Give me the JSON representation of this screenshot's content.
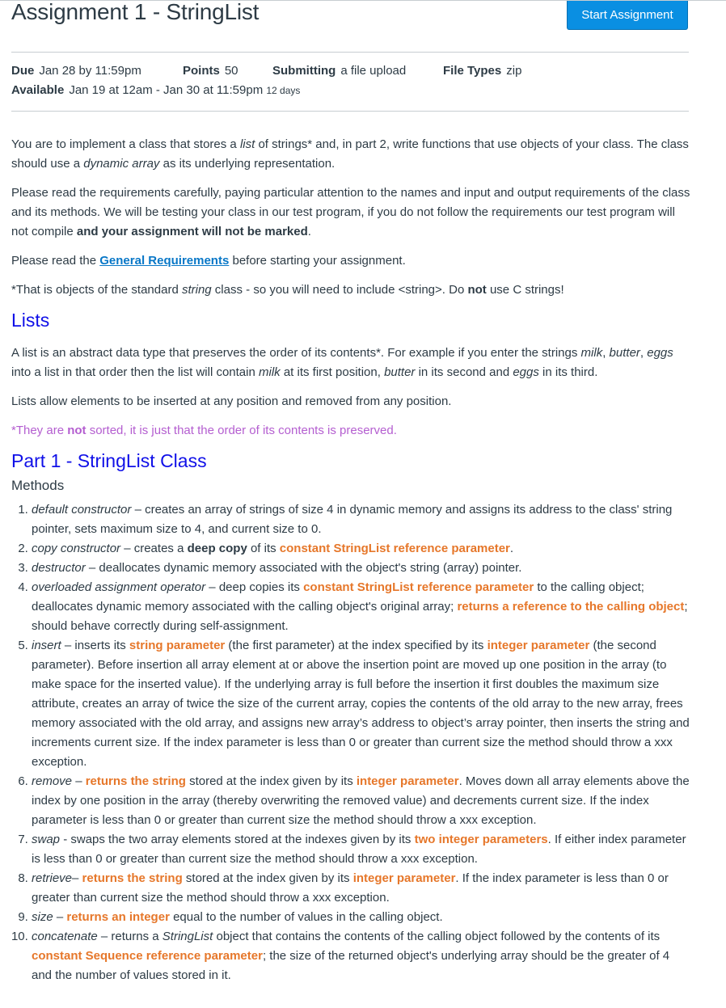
{
  "header": {
    "title": "Assignment 1 - StringList",
    "start_button": "Start Assignment"
  },
  "details": {
    "due_label": "Due",
    "due_value": "Jan 28 by 11:59pm",
    "points_label": "Points",
    "points_value": "50",
    "submitting_label": "Submitting",
    "submitting_value": "a file upload",
    "filetypes_label": "File Types",
    "filetypes_value": "zip",
    "available_label": "Available",
    "available_value": "Jan 19 at 12am - Jan 30 at 11:59pm",
    "available_duration": "12 days"
  },
  "intro": {
    "p1_a": "You are to implement a class that stores a ",
    "p1_list": "list",
    "p1_b": " of strings* and, in part 2, write functions that use objects of your class. The class should use a ",
    "p1_dyn": "dynamic array",
    "p1_c": " as its underlying representation.",
    "p2_a": "Please read the requirements carefully, paying particular attention to the names and input and output requirements of the class and its methods. We will be testing your class in our test program, if you do not follow the requirements our test program will not compile ",
    "p2_bold": "and your assignment will not be marked",
    "p2_c": ".",
    "p3_a": "Please read the ",
    "p3_link": "General Requirements",
    "p3_b": " before starting your assignment.",
    "p4_a": "*That is objects of the standard ",
    "p4_string": "string",
    "p4_b": " class - so you will need to include <string>. Do ",
    "p4_not": "not",
    "p4_c": " use C strings!"
  },
  "lists": {
    "heading": "Lists",
    "p1_a": "A list is an abstract data type that preserves the order of its contents*. For example if you enter the strings ",
    "milk": "milk",
    "comma1": ", ",
    "butter": "butter",
    "comma2": ", ",
    "eggs": "eggs",
    "p1_b": " into a list in that order then the list will contain ",
    "p1_c": " at its first position, ",
    "p1_d": " in its second and ",
    "p1_e": " in its third.",
    "p2": "Lists allow elements to be inserted at any position and removed from any position.",
    "note_a": "*They are ",
    "note_not": "not",
    "note_b": " sorted, it is just that the order of its contents is preserved."
  },
  "part1": {
    "heading": "Part 1 - StringList Class",
    "subheading": "Methods",
    "methods": [
      {
        "name": "default constructor",
        "t1": " – creates an array of strings of size 4 in dynamic memory and assigns its address to the class' string pointer, sets maximum size to 4, and current size to 0."
      },
      {
        "name": "copy constructor",
        "t1": " – creates a ",
        "b1": "deep copy",
        "t2": " of its ",
        "o1": "constant StringList reference parameter",
        "t3": "."
      },
      {
        "name": "destructor",
        "t1": " – deallocates dynamic memory associated with the object's string (array) pointer."
      },
      {
        "name": "overloaded assignment operator",
        "t1": " – deep copies its ",
        "o1": "constant StringList reference parameter",
        "t2": " to the calling object; deallocates dynamic memory associated with the calling object's original array; ",
        "o2": "returns a reference to the calling object",
        "t3": "; should behave correctly during self-assignment."
      },
      {
        "name": "insert",
        "t1": " – inserts its ",
        "o1": "string parameter",
        "t2": " (the first parameter) at the index specified by its ",
        "o2": "integer parameter",
        "t3": " (the second parameter). Before insertion all array element at or above the insertion point are moved up one position in the array (to make space for the inserted value). If the underlying array is full before the insertion it first doubles the maximum size attribute, creates an array of twice the size of the current array, copies the contents of the old array to the new array, frees memory associated with the old array, and assigns new array’s address to object’s array pointer, then inserts the string and increments current size. If the index parameter is less than 0 or greater than current size the method should throw a xxx exception."
      },
      {
        "name": "remove",
        "t1": " – ",
        "o1": "returns the string",
        "t2": " stored at the index given by its ",
        "o2": "integer parameter",
        "t3": ". Moves down all array elements above the index by one position in the array (thereby overwriting the removed value) and decrements current size. If the index parameter is less than 0 or greater than current size the method should throw a xxx exception."
      },
      {
        "name": "swap",
        "t1": " - swaps the two array elements stored at the indexes given by its ",
        "o1": "two integer parameters",
        "t2": ". If either index parameter is less than 0 or greater than current size the method should throw a xxx exception."
      },
      {
        "name": "retrieve",
        "t1": "– ",
        "o1": "returns the string",
        "t2": " stored at the index given by its ",
        "o2": "integer parameter",
        "t3": ". If the index parameter is less than 0 or greater than current size the method should throw a xxx exception."
      },
      {
        "name": "size",
        "t1": " – ",
        "o1": "returns an integer",
        "t2": " equal to the number of values in the calling object."
      },
      {
        "name": "concatenate",
        "t1": " – returns a ",
        "i1": "StringList",
        "t2": " object that contains the contents of the calling object followed by the contents of its ",
        "o1": "constant Sequence reference parameter",
        "t3": "; the size of the returned object's underlying array should be the greater of 4 and the number of values stored in it."
      }
    ]
  },
  "colors": {
    "button": "#0a8fe2",
    "heading_blue": "#1010e8",
    "link": "#0877c7",
    "orange": "#e6772a",
    "purple": "#b45ed0",
    "text": "#2d3b45"
  }
}
